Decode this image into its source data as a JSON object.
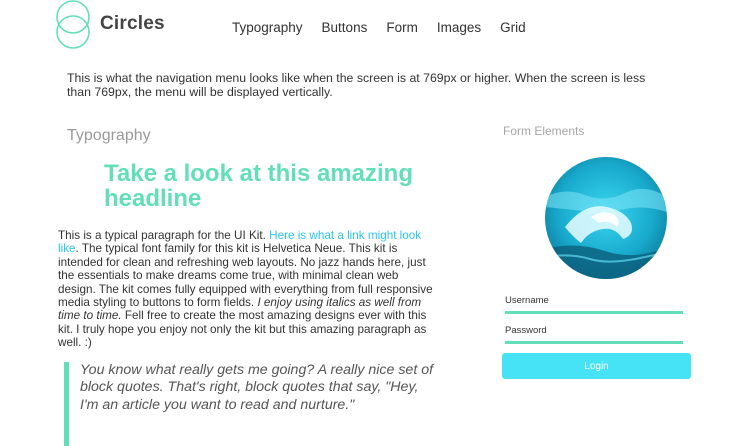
{
  "brand": {
    "name": "Circles"
  },
  "nav": {
    "items": [
      "Typography",
      "Buttons",
      "Form",
      "Images",
      "Grid"
    ]
  },
  "intro": "This is what the navigation menu looks like when the screen is at 769px or higher. When the screen is less than 769px, the menu will be displayed vertically.",
  "typography": {
    "title": "Typography",
    "headline": "Take a look at this amazing headline",
    "paragraph": {
      "before_link": "This is a typical paragraph for the UI Kit. ",
      "link": "Here is what a link might look like",
      "middle": ". The typical font family for this kit is Helvetica Neue. This kit is intended for clean and refreshing web layouts. No jazz hands here, just the essentials to make dreams come true, with minimal clean web design. The kit comes fully equipped with everything from full responsive media styling to buttons to form fields. ",
      "italic": "I enjoy using italics as well from time to time.",
      "after": " Fell free to create the most amazing designs ever with this kit. I truly hope you enjoy not only the kit but this amazing paragraph as well. :)"
    },
    "quote": "You know what really gets me going? A really nice set of block quotes. That's right, block quotes that say, \"Hey, I'm an article you want to read and nurture.\""
  },
  "form": {
    "title": "Form Elements",
    "username_label": "Username",
    "password_label": "Password",
    "login_label": "Login"
  },
  "colors": {
    "accent_green": "#62dfb9",
    "link_blue": "#29c6ec",
    "button_cyan": "#45e3f5"
  }
}
